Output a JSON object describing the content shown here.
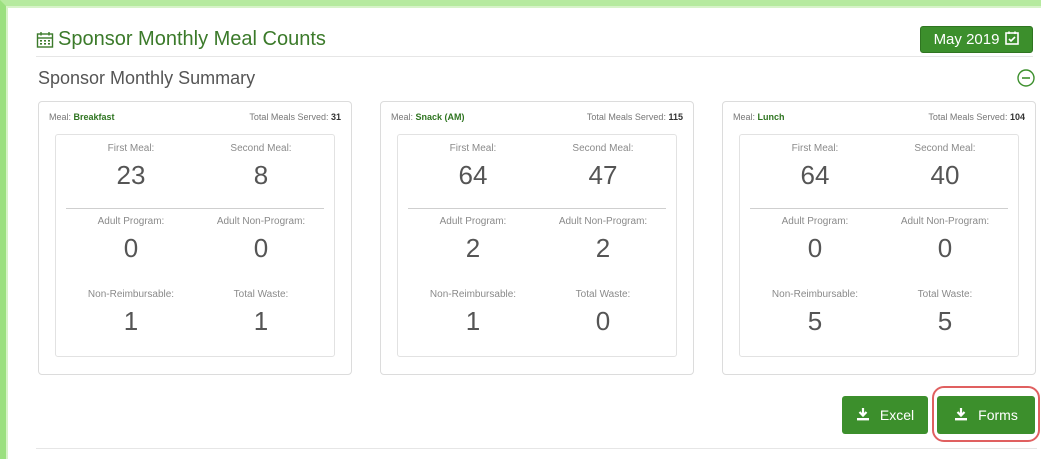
{
  "header": {
    "title": "Sponsor Monthly Meal Counts",
    "month_label": "May 2019",
    "calendar_icon": "calendar-icon",
    "accent": "#3c8f2c"
  },
  "summary": {
    "title": "Sponsor Monthly Summary",
    "collapse_icon": "minus-circle-icon"
  },
  "cards": [
    {
      "meal_label": "Meal:",
      "meal": "Breakfast",
      "served_label": "Total Meals Served:",
      "served": "31",
      "stats": [
        {
          "label": "First Meal:",
          "value": "23"
        },
        {
          "label": "Second Meal:",
          "value": "8"
        },
        {
          "label": "Adult Program:",
          "value": "0"
        },
        {
          "label": "Adult Non-Program:",
          "value": "0"
        },
        {
          "label": "Non-Reimbursable:",
          "value": "1"
        },
        {
          "label": "Total Waste:",
          "value": "1"
        }
      ]
    },
    {
      "meal_label": "Meal:",
      "meal": "Snack (AM)",
      "served_label": "Total Meals Served:",
      "served": "115",
      "stats": [
        {
          "label": "First Meal:",
          "value": "64"
        },
        {
          "label": "Second Meal:",
          "value": "47"
        },
        {
          "label": "Adult Program:",
          "value": "2"
        },
        {
          "label": "Adult Non-Program:",
          "value": "2"
        },
        {
          "label": "Non-Reimbursable:",
          "value": "1"
        },
        {
          "label": "Total Waste:",
          "value": "0"
        }
      ]
    },
    {
      "meal_label": "Meal:",
      "meal": "Lunch",
      "served_label": "Total Meals Served:",
      "served": "104",
      "stats": [
        {
          "label": "First Meal:",
          "value": "64"
        },
        {
          "label": "Second Meal:",
          "value": "40"
        },
        {
          "label": "Adult Program:",
          "value": "0"
        },
        {
          "label": "Adult Non-Program:",
          "value": "0"
        },
        {
          "label": "Non-Reimbursable:",
          "value": "5"
        },
        {
          "label": "Total Waste:",
          "value": "5"
        }
      ]
    }
  ],
  "actions": {
    "excel_label": "Excel",
    "forms_label": "Forms",
    "download_icon": "download-icon",
    "highlight_color": "#e06060"
  }
}
